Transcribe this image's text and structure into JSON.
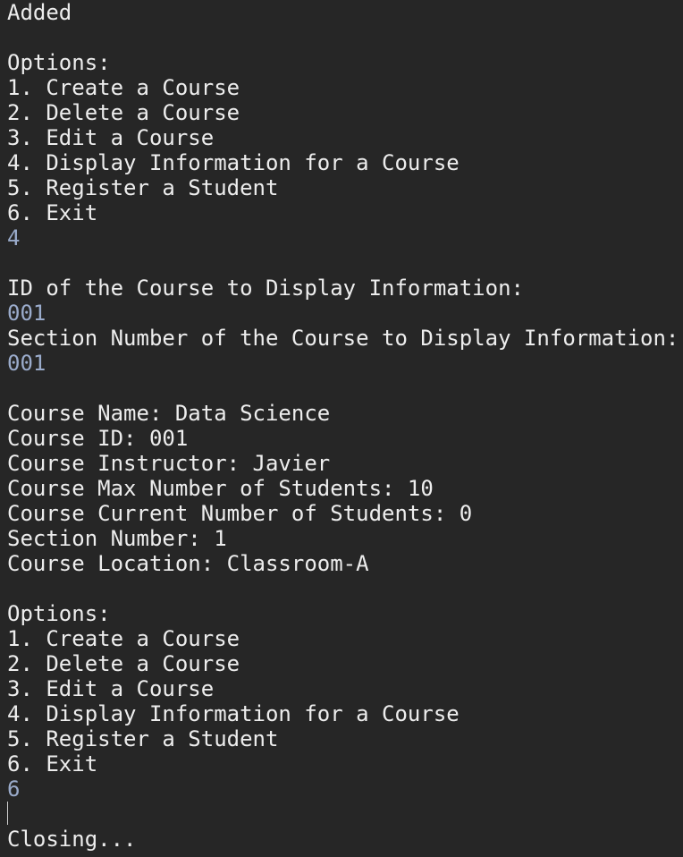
{
  "terminal": {
    "lines": [
      {
        "text": "Added",
        "kind": "output"
      },
      {
        "text": "",
        "kind": "output"
      },
      {
        "text": "Options:",
        "kind": "output"
      },
      {
        "text": "1. Create a Course",
        "kind": "output"
      },
      {
        "text": "2. Delete a Course",
        "kind": "output"
      },
      {
        "text": "3. Edit a Course",
        "kind": "output"
      },
      {
        "text": "4. Display Information for a Course",
        "kind": "output"
      },
      {
        "text": "5. Register a Student",
        "kind": "output"
      },
      {
        "text": "6. Exit",
        "kind": "output"
      },
      {
        "text": "4",
        "kind": "input"
      },
      {
        "text": "",
        "kind": "output"
      },
      {
        "text": "ID of the Course to Display Information:",
        "kind": "output"
      },
      {
        "text": "001",
        "kind": "input"
      },
      {
        "text": "Section Number of the Course to Display Information:",
        "kind": "output"
      },
      {
        "text": "001",
        "kind": "input"
      },
      {
        "text": "",
        "kind": "output"
      },
      {
        "text": "Course Name: Data Science",
        "kind": "output"
      },
      {
        "text": "Course ID: 001",
        "kind": "output"
      },
      {
        "text": "Course Instructor: Javier",
        "kind": "output"
      },
      {
        "text": "Course Max Number of Students: 10",
        "kind": "output"
      },
      {
        "text": "Course Current Number of Students: 0",
        "kind": "output"
      },
      {
        "text": "Section Number: 1",
        "kind": "output"
      },
      {
        "text": "Course Location: Classroom-A",
        "kind": "output"
      },
      {
        "text": "",
        "kind": "output"
      },
      {
        "text": "Options:",
        "kind": "output"
      },
      {
        "text": "1. Create a Course",
        "kind": "output"
      },
      {
        "text": "2. Delete a Course",
        "kind": "output"
      },
      {
        "text": "3. Edit a Course",
        "kind": "output"
      },
      {
        "text": "4. Display Information for a Course",
        "kind": "output"
      },
      {
        "text": "5. Register a Student",
        "kind": "output"
      },
      {
        "text": "6. Exit",
        "kind": "output"
      },
      {
        "text": "6",
        "kind": "input"
      },
      {
        "text": "",
        "kind": "cursor"
      },
      {
        "text": "Closing...",
        "kind": "output"
      }
    ]
  },
  "colors": {
    "background": "#262626",
    "output_text": "#ededed",
    "input_text": "#9aabcb"
  }
}
